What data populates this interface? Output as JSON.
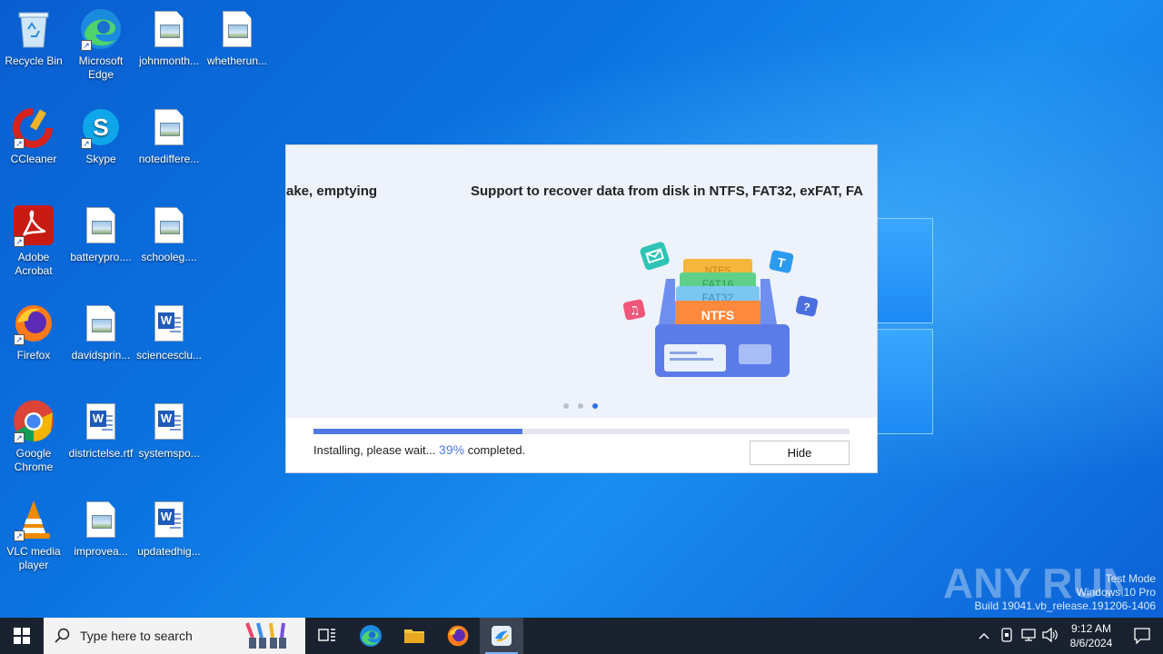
{
  "desktop": {
    "icons": [
      {
        "label": "Recycle Bin",
        "icon": "recycle-bin-icon"
      },
      {
        "label": "Microsoft Edge",
        "icon": "edge-icon"
      },
      {
        "label": "johnmonth...",
        "icon": "image-file-icon"
      },
      {
        "label": "whetherun...",
        "icon": "image-file-icon"
      },
      {
        "label": "CCleaner",
        "icon": "ccleaner-icon"
      },
      {
        "label": "Skype",
        "icon": "skype-icon"
      },
      {
        "label": "notediffere...",
        "icon": "image-file-icon"
      },
      {
        "label": "Adobe Acrobat",
        "icon": "acrobat-icon"
      },
      {
        "label": "batterypro....",
        "icon": "image-file-icon"
      },
      {
        "label": "schooleg....",
        "icon": "image-file-icon"
      },
      {
        "label": "Firefox",
        "icon": "firefox-icon"
      },
      {
        "label": "davidsprin...",
        "icon": "image-file-icon"
      },
      {
        "label": "sciencesclu...",
        "icon": "word-doc-icon"
      },
      {
        "label": "Google Chrome",
        "icon": "chrome-icon"
      },
      {
        "label": "districtelse.rtf",
        "icon": "word-doc-icon"
      },
      {
        "label": "systemspo...",
        "icon": "word-doc-icon"
      },
      {
        "label": "VLC media player",
        "icon": "vlc-icon"
      },
      {
        "label": "improvea...",
        "icon": "image-file-icon"
      },
      {
        "label": "updatedhig...",
        "icon": "word-doc-icon"
      }
    ]
  },
  "installer": {
    "slide_prev_text": "ake, emptying",
    "slide_text": "Support to recover data from disk in NTFS, FAT32, exFAT, FA",
    "illustration_labels": [
      "NTFS",
      "FAT16",
      "FAT32",
      "NTFS"
    ],
    "progress_percent": 39,
    "status_prefix": "Installing, please wait...",
    "status_percent": "39%",
    "status_suffix": "completed.",
    "hide_label": "Hide",
    "dots": 3,
    "active_dot": 2
  },
  "watermark": {
    "brand": "ANY RUN",
    "line1": "Test Mode",
    "line2": "Windows 10 Pro",
    "line3": "Build 19041.vb_release.191206-1406"
  },
  "taskbar": {
    "search_placeholder": "Type here to search",
    "time": "9:12 AM",
    "date": "8/6/2024"
  },
  "colors": {
    "accent": "#4f7ae6",
    "taskbar": "#1a2230"
  }
}
